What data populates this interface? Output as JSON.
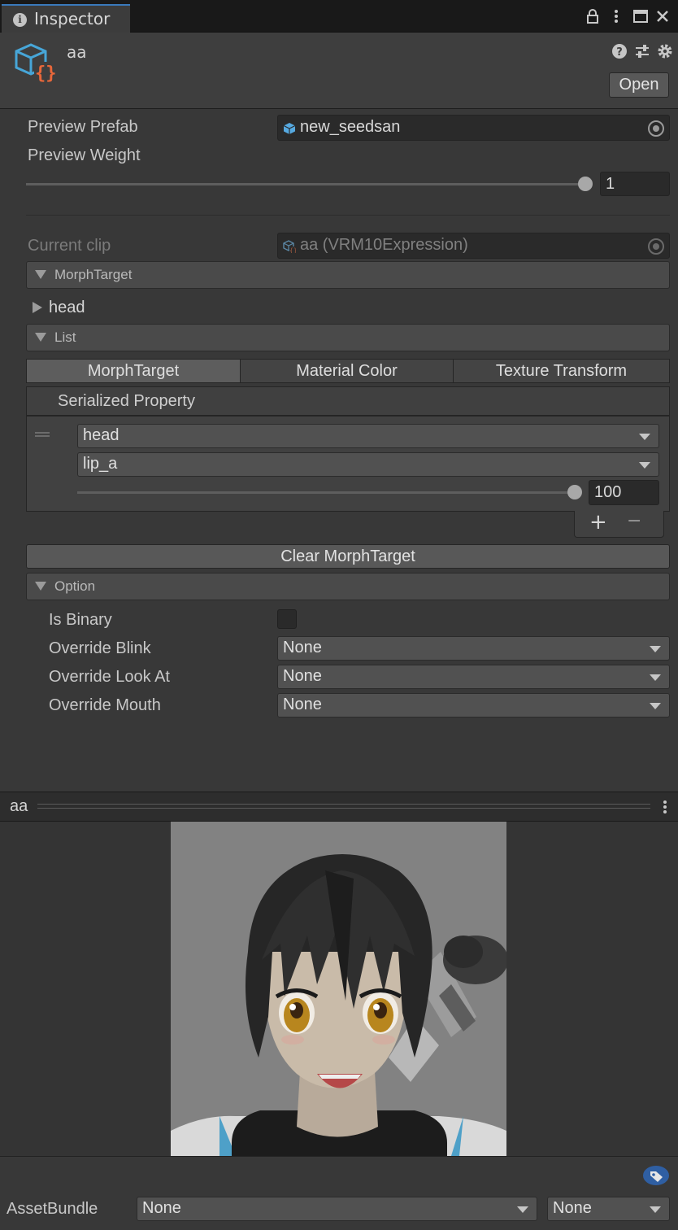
{
  "tab": {
    "title": "Inspector"
  },
  "tab_icons": [
    "lock-icon",
    "kebab-menu-icon",
    "maximize-icon",
    "close-icon"
  ],
  "header": {
    "asset_name": "aa",
    "open_label": "Open",
    "icons": [
      "help-icon",
      "presets-icon",
      "settings-icon"
    ]
  },
  "preview_prefab": {
    "label": "Preview Prefab",
    "value": "new_seedsan"
  },
  "preview_weight": {
    "label": "Preview Weight",
    "value": "1",
    "level": 1.0
  },
  "current_clip": {
    "label": "Current clip",
    "value": "aa (VRM10Expression)"
  },
  "morph_foldout": {
    "label": "MorphTarget"
  },
  "head_item": {
    "label": "head"
  },
  "list_foldout": {
    "label": "List"
  },
  "tabs": [
    {
      "label": "MorphTarget",
      "active": true
    },
    {
      "label": "Material Color",
      "active": false
    },
    {
      "label": "Texture Transform",
      "active": false
    }
  ],
  "serialized_property": {
    "label": "Serialized Property"
  },
  "entry": {
    "mesh": "head",
    "blendshape": "lip_a",
    "weight": "100",
    "weight_level": 1.0
  },
  "list_buttons": {
    "add": "+",
    "remove": "−"
  },
  "clear_button": {
    "label": "Clear MorphTarget"
  },
  "option_foldout": {
    "label": "Option"
  },
  "options": {
    "is_binary": {
      "label": "Is Binary",
      "checked": false
    },
    "override_blink": {
      "label": "Override Blink",
      "value": "None"
    },
    "override_look_at": {
      "label": "Override Look At",
      "value": "None"
    },
    "override_mouth": {
      "label": "Override Mouth",
      "value": "None"
    }
  },
  "preview": {
    "title": "aa"
  },
  "asset_bundle": {
    "label": "AssetBundle",
    "name": "None",
    "variant": "None"
  },
  "colors": {
    "accent": "#3a79bb",
    "panel": "#383838",
    "tab_highlight": "#3a79bb",
    "tag_badge": "#2f5fa3"
  }
}
